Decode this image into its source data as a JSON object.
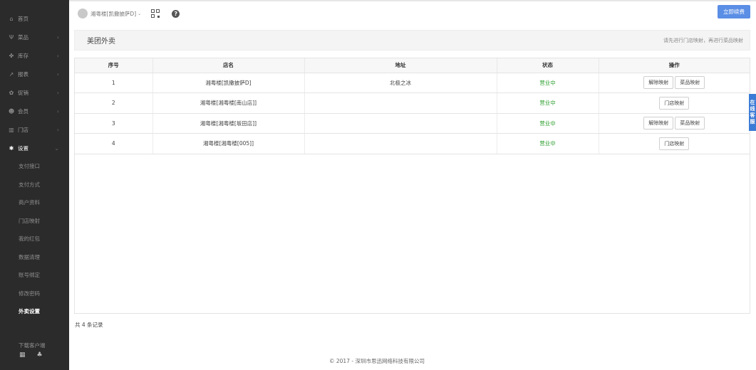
{
  "sidebar": {
    "items": [
      {
        "icon": "home-icon",
        "glyph": "⌂",
        "label": "首页",
        "arrow": ""
      },
      {
        "icon": "dish-icon",
        "glyph": "Ψ",
        "label": "菜品",
        "arrow": "›"
      },
      {
        "icon": "inventory-icon",
        "glyph": "✤",
        "label": "库存",
        "arrow": "›"
      },
      {
        "icon": "report-icon",
        "glyph": "↗",
        "label": "报表",
        "arrow": "›"
      },
      {
        "icon": "promo-icon",
        "glyph": "✿",
        "label": "促销",
        "arrow": "›"
      },
      {
        "icon": "member-icon",
        "glyph": "☻",
        "label": "会员",
        "arrow": "›"
      },
      {
        "icon": "store-icon",
        "glyph": "▥",
        "label": "门店",
        "arrow": "›"
      },
      {
        "icon": "settings-icon",
        "glyph": "✱",
        "label": "设置",
        "arrow": "⌄"
      }
    ],
    "sub_items": [
      "支付接口",
      "支付方式",
      "商户资料",
      "门店映射",
      "我的红包",
      "数据清理",
      "账号绑定",
      "修改密码",
      "外卖设置"
    ],
    "download_label": "下载客户端"
  },
  "header": {
    "store_name": "湘粤楼[凯撒披萨D]",
    "renew_label": "立即续费"
  },
  "main": {
    "title": "美团外卖",
    "hint": "请先进行门店映射，再进行菜品映射",
    "columns": [
      "序号",
      "店名",
      "地址",
      "状态",
      "操作"
    ],
    "rows": [
      {
        "no": "1",
        "name": "湘粤楼[凯撒披萨D]",
        "address": "北极之冰",
        "status": "营业中",
        "actions": [
          "解除映射",
          "菜品映射"
        ]
      },
      {
        "no": "2",
        "name": "湘粤楼[湘粤楼[南山店]]",
        "address": "",
        "status": "营业中",
        "actions": [
          "门店映射"
        ]
      },
      {
        "no": "3",
        "name": "湘粤楼[湘粤楼[坂田店]]",
        "address": "",
        "status": "营业中",
        "actions": [
          "解除映射",
          "菜品映射"
        ]
      },
      {
        "no": "4",
        "name": "湘粤楼[湘粤楼[005]]",
        "address": "",
        "status": "营业中",
        "actions": [
          "门店映射"
        ]
      }
    ],
    "record_count": "共 4 条记录"
  },
  "footer": "© 2017 - 深圳市思迅网络科技有限公司",
  "online_service": "在线客服",
  "colors": {
    "accent": "#5b8ee5",
    "status_green": "#2fa030",
    "sidebar_bg": "#2b2b2b"
  }
}
